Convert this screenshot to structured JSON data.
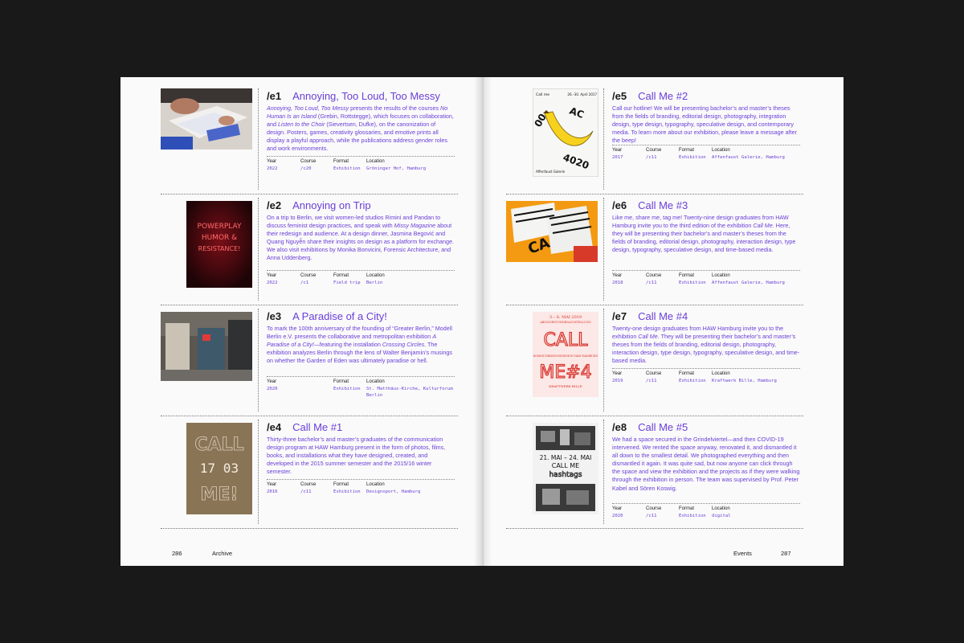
{
  "left_page": {
    "page_number": "286",
    "running_head": "Archive",
    "entries": [
      {
        "code": "/e1",
        "title": "Annoying, Too Loud, Too Messy",
        "body": "<i>Annoying, Too Loud, Too Messy</i> presents the results of the courses <i>No Human Is an Island</i> (Grebin, Rottstegge), which focuses on collaboration, and <i>Listen to the Choir</i> (Sievertsen, Dufke), on the canonization of design. Posters, games, creativity glossaries, and emotive prints all display a playful approach, while the publications address gender roles and work environments.",
        "year": "2022",
        "course": "/c20",
        "format": "Exhibition",
        "location": "Gröninger Hof, Hamburg"
      },
      {
        "code": "/e2",
        "title": "Annoying on Trip",
        "body": "On a trip to Berlin, we visit women-led studios Rimini and Pandan to discuss feminist design practices, and speak with <i>Missy Magazine</i> about their redesign and audience. At a design dinner, Jasmina Begović and Quang Nguyễn share their insights on design as a platform for exchange. We also visit exhibitions by Monika Bonvicini, Forensic Architecture, and Anna Uddenberg.",
        "year": "2022",
        "course": "/c1",
        "format": "Field trip",
        "location": "Berlin"
      },
      {
        "code": "/e3",
        "title": "A Paradise of a City!",
        "body": "To mark the 100th anniversary of the founding of “Greater Berlin,” Modell Berlin e.V. presents the collaborative and metropolitan exhibition <i>A Paradise of a City!</i>—featuring the installation <i>Crossing Circles</i>. The exhibition analyzes Berlin through the lens of Walter Benjamin’s musings on whether the Garden of Eden was ultimately paradise or hell.",
        "year": "2020",
        "course": "",
        "format": "Exhibition",
        "location": "St. Matthäus-Kirche, Kulturforum Berlin"
      },
      {
        "code": "/e4",
        "title": "Call Me #1",
        "body": "Thirty-three bachelor’s and master’s graduates of the communication design program at HAW Hamburg present in the form of photos, films, books, and installations what they have designed, created, and developed in the 2015 summer semester and the 2015/16 winter semester.",
        "year": "2016",
        "course": "/c11",
        "format": "Exhibition",
        "location": "Designxport, Hamburg"
      }
    ]
  },
  "right_page": {
    "page_number": "287",
    "running_head": "Events",
    "entries": [
      {
        "code": "/e5",
        "title": "Call Me #2",
        "body": "Call our hotline! We will be presenting bachelor’s and master’s theses from the fields of branding, editorial design, photography, integration design, type design, typography, speculative design, and contemporary media. To learn more about our exhibition, please leave a message after the beep!",
        "year": "2017",
        "course": "/c11",
        "format": "Exhibition",
        "location": "Affenfaust Galerie, Hamburg"
      },
      {
        "code": "/e6",
        "title": "Call Me #3",
        "body": "Like me, share me, tag me! Twenty-nine design graduates from HAW Hamburg invite you to the third edition of the exhibition <i>Call Me</i>. Here, they will be presenting their bachelor’s and master’s theses from the fields of branding, editorial design, photography, interaction design, type design, typography, speculative design, and time-based media.",
        "year": "2018",
        "course": "/c11",
        "format": "Exhibition",
        "location": "Affenfaust Galerie, Hamburg"
      },
      {
        "code": "/e7",
        "title": "Call Me #4",
        "body": "Twenty-one design graduates from HAW Hamburg invite you to the exhibition <i>Call Me</i>. They will be presenting their bachelor’s and master’s theses from the fields of branding, editorial design, photography, interaction design, type design, typography, speculative design, and time-based media.",
        "year": "2019",
        "course": "/c11",
        "format": "Exhibition",
        "location": "Kraftwerk Bille, Hamburg"
      },
      {
        "code": "/e8",
        "title": "Call Me #5",
        "body": "We had a space secured in the Grindelviertel—and then COVID-19 intervened. We rented the space anyway, renovated it, and dismantled it all down to the smallest detail. We photographed everything and then dismantled it again. It was quite sad, but now anyone can click through the space and view the exhibition and the projects as if they were walking through the exhibition in person. The team was supervised by Prof. Peter Kabel and Sören Koswig.",
        "year": "2020",
        "course": "/c11",
        "format": "Exhibition",
        "location": "digital"
      }
    ]
  },
  "labels": {
    "year": "Year",
    "course": "Course",
    "format": "Format",
    "location": "Location"
  },
  "thumb_text": {
    "e2_neon": [
      "POWERPLAY",
      "HUMOR &",
      "RESISTANCE!"
    ],
    "e4_poster": [
      "CALL",
      "17 03",
      "ME!"
    ],
    "e5_poster_top": "Call me",
    "e5_poster_dates": "26.–30. April 2017",
    "e5_poster_footer": "Affenfaust Galerie",
    "e7_poster_top": "3.– 6. MAI 2019",
    "e7_poster_sub": "ABSOLVENT:INNENAUSSTELLUNG",
    "e7_poster_big": [
      "CALL",
      "ME#4"
    ],
    "e7_poster_mid": "KOMMUNIKATIONSDESIGN HAW HAMBURG",
    "e7_poster_bottom": "KRAFTWERK BILLE",
    "e8_poster": [
      "21. MAI – 24. MAI",
      "CALL ME",
      "hashtags"
    ]
  },
  "colors": {
    "accent": "#6a3fd8",
    "text": "#1a1a1a",
    "paper": "#fafafa",
    "background": "#191919"
  }
}
